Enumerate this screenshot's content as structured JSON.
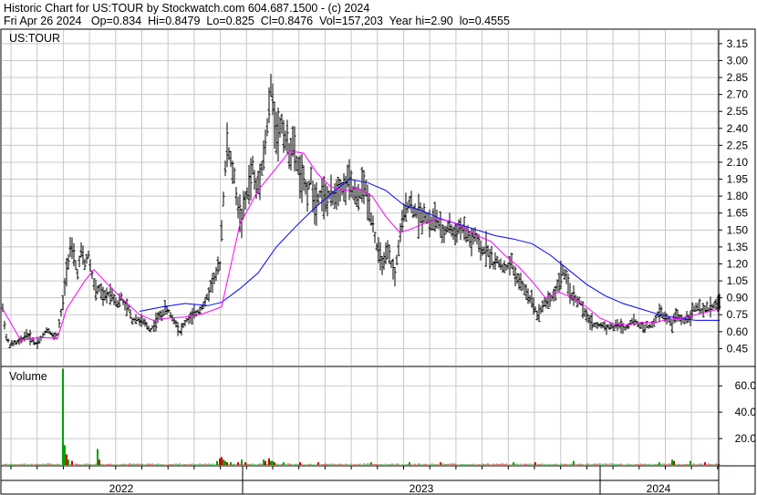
{
  "header": {
    "line1": "Historic Chart for US:TOUR by Stockwatch.com 604.687.1500 - (c) 2024",
    "line2": "Fri Apr 26 2024   Op=0.834  Hi=0.8479  Lo=0.825  Cl=0.8476  Vol=157,203  Year hi=2.90  lo=0.4555"
  },
  "chart_data": [
    {
      "type": "line",
      "title": "US:TOUR",
      "subtype": "OHLC price bars with two moving averages",
      "ylim": [
        0.3,
        3.27
      ],
      "y_ticks": [
        "3.15",
        "3.00",
        "2.85",
        "2.70",
        "2.55",
        "2.40",
        "2.25",
        "2.10",
        "1.95",
        "1.80",
        "1.65",
        "1.50",
        "1.35",
        "1.20",
        "1.05",
        "0.90",
        "0.75",
        "0.60",
        "0.45"
      ],
      "grid": true,
      "colors": {
        "short_ma": "#ff00ff",
        "long_ma": "#0000ff",
        "price": "#000000",
        "grid": "#c8c8c8"
      },
      "price_keypoints": [
        [
          0,
          0.8
        ],
        [
          4,
          0.55
        ],
        [
          8,
          0.48
        ],
        [
          14,
          0.5
        ],
        [
          20,
          0.52
        ],
        [
          26,
          0.58
        ],
        [
          32,
          0.53
        ],
        [
          36,
          0.5
        ],
        [
          40,
          0.52
        ],
        [
          44,
          0.56
        ],
        [
          48,
          0.62
        ],
        [
          52,
          0.6
        ],
        [
          56,
          0.55
        ],
        [
          60,
          0.58
        ],
        [
          66,
          0.85
        ],
        [
          70,
          1.15
        ],
        [
          74,
          1.35
        ],
        [
          78,
          1.25
        ],
        [
          82,
          1.12
        ],
        [
          86,
          1.3
        ],
        [
          90,
          1.2
        ],
        [
          94,
          1.28
        ],
        [
          98,
          1.1
        ],
        [
          102,
          0.95
        ],
        [
          106,
          0.98
        ],
        [
          110,
          0.9
        ],
        [
          114,
          0.92
        ],
        [
          118,
          0.95
        ],
        [
          122,
          0.9
        ],
        [
          126,
          0.85
        ],
        [
          130,
          0.9
        ],
        [
          134,
          0.82
        ],
        [
          138,
          0.8
        ],
        [
          142,
          0.7
        ],
        [
          146,
          0.72
        ],
        [
          150,
          0.7
        ],
        [
          154,
          0.68
        ],
        [
          158,
          0.65
        ],
        [
          162,
          0.62
        ],
        [
          166,
          0.66
        ],
        [
          170,
          0.72
        ],
        [
          174,
          0.75
        ],
        [
          178,
          0.8
        ],
        [
          182,
          0.78
        ],
        [
          186,
          0.72
        ],
        [
          190,
          0.68
        ],
        [
          194,
          0.6
        ],
        [
          198,
          0.65
        ],
        [
          202,
          0.7
        ],
        [
          206,
          0.72
        ],
        [
          210,
          0.75
        ],
        [
          214,
          0.78
        ],
        [
          218,
          0.82
        ],
        [
          222,
          0.85
        ],
        [
          226,
          0.95
        ],
        [
          230,
          1.05
        ],
        [
          234,
          1.1
        ],
        [
          238,
          1.2
        ],
        [
          242,
          1.8
        ],
        [
          246,
          2.25
        ],
        [
          250,
          2.1
        ],
        [
          254,
          1.95
        ],
        [
          258,
          1.7
        ],
        [
          262,
          1.6
        ],
        [
          266,
          1.75
        ],
        [
          270,
          1.9
        ],
        [
          274,
          2.05
        ],
        [
          278,
          1.85
        ],
        [
          282,
          2.0
        ],
        [
          286,
          2.15
        ],
        [
          290,
          2.4
        ],
        [
          294,
          2.75
        ],
        [
          298,
          2.5
        ],
        [
          302,
          2.35
        ],
        [
          306,
          2.45
        ],
        [
          310,
          2.3
        ],
        [
          314,
          2.2
        ],
        [
          318,
          2.25
        ],
        [
          322,
          2.1
        ],
        [
          326,
          2.0
        ],
        [
          330,
          1.9
        ],
        [
          334,
          1.85
        ],
        [
          338,
          1.95
        ],
        [
          342,
          1.75
        ],
        [
          346,
          1.8
        ],
        [
          350,
          1.85
        ],
        [
          354,
          1.75
        ],
        [
          358,
          1.8
        ],
        [
          362,
          1.78
        ],
        [
          366,
          1.85
        ],
        [
          370,
          1.9
        ],
        [
          374,
          1.85
        ],
        [
          378,
          1.95
        ],
        [
          382,
          1.88
        ],
        [
          386,
          1.8
        ],
        [
          390,
          1.75
        ],
        [
          394,
          1.9
        ],
        [
          398,
          1.85
        ],
        [
          402,
          1.7
        ],
        [
          406,
          1.55
        ],
        [
          410,
          1.35
        ],
        [
          414,
          1.25
        ],
        [
          418,
          1.2
        ],
        [
          422,
          1.3
        ],
        [
          426,
          1.2
        ],
        [
          430,
          1.1
        ],
        [
          434,
          1.35
        ],
        [
          438,
          1.55
        ],
        [
          442,
          1.7
        ],
        [
          446,
          1.75
        ],
        [
          450,
          1.68
        ],
        [
          454,
          1.65
        ],
        [
          458,
          1.62
        ],
        [
          462,
          1.65
        ],
        [
          466,
          1.6
        ],
        [
          470,
          1.55
        ],
        [
          474,
          1.62
        ],
        [
          478,
          1.55
        ],
        [
          482,
          1.45
        ],
        [
          486,
          1.5
        ],
        [
          490,
          1.55
        ],
        [
          494,
          1.45
        ],
        [
          498,
          1.5
        ],
        [
          502,
          1.52
        ],
        [
          506,
          1.48
        ],
        [
          510,
          1.45
        ],
        [
          514,
          1.4
        ],
        [
          518,
          1.45
        ],
        [
          522,
          1.35
        ],
        [
          526,
          1.3
        ],
        [
          530,
          1.35
        ],
        [
          534,
          1.28
        ],
        [
          538,
          1.2
        ],
        [
          542,
          1.22
        ],
        [
          546,
          1.2
        ],
        [
          550,
          1.15
        ],
        [
          554,
          1.18
        ],
        [
          558,
          1.2
        ],
        [
          562,
          1.1
        ],
        [
          566,
          1.05
        ],
        [
          570,
          1.0
        ],
        [
          574,
          0.95
        ],
        [
          578,
          0.9
        ],
        [
          582,
          0.85
        ],
        [
          586,
          0.75
        ],
        [
          590,
          0.8
        ],
        [
          594,
          0.85
        ],
        [
          598,
          0.88
        ],
        [
          602,
          0.9
        ],
        [
          606,
          0.95
        ],
        [
          610,
          1.05
        ],
        [
          614,
          1.15
        ],
        [
          618,
          1.05
        ],
        [
          622,
          0.95
        ],
        [
          626,
          0.9
        ],
        [
          630,
          0.88
        ],
        [
          634,
          0.85
        ],
        [
          638,
          0.75
        ],
        [
          642,
          0.72
        ],
        [
          646,
          0.68
        ],
        [
          650,
          0.66
        ],
        [
          654,
          0.65
        ],
        [
          658,
          0.66
        ],
        [
          662,
          0.64
        ],
        [
          666,
          0.65
        ],
        [
          670,
          0.64
        ],
        [
          674,
          0.66
        ],
        [
          678,
          0.65
        ],
        [
          682,
          0.63
        ],
        [
          686,
          0.66
        ],
        [
          690,
          0.7
        ],
        [
          694,
          0.68
        ],
        [
          698,
          0.66
        ],
        [
          702,
          0.64
        ],
        [
          706,
          0.65
        ],
        [
          710,
          0.64
        ],
        [
          714,
          0.68
        ],
        [
          718,
          0.75
        ],
        [
          722,
          0.78
        ],
        [
          726,
          0.72
        ],
        [
          730,
          0.7
        ],
        [
          734,
          0.66
        ],
        [
          738,
          0.75
        ],
        [
          742,
          0.72
        ],
        [
          746,
          0.7
        ],
        [
          750,
          0.72
        ],
        [
          754,
          0.75
        ],
        [
          758,
          0.8
        ],
        [
          762,
          0.82
        ],
        [
          766,
          0.78
        ],
        [
          770,
          0.8
        ],
        [
          774,
          0.8
        ],
        [
          778,
          0.83
        ],
        [
          782,
          0.84
        ],
        [
          786,
          0.85
        ]
      ],
      "short_ma_keypoints": [
        [
          0,
          0.8
        ],
        [
          20,
          0.52
        ],
        [
          40,
          0.55
        ],
        [
          60,
          0.54
        ],
        [
          70,
          0.8
        ],
        [
          90,
          1.05
        ],
        [
          100,
          1.15
        ],
        [
          115,
          1.02
        ],
        [
          130,
          0.9
        ],
        [
          150,
          0.75
        ],
        [
          165,
          0.7
        ],
        [
          180,
          0.72
        ],
        [
          200,
          0.73
        ],
        [
          220,
          0.76
        ],
        [
          240,
          0.82
        ],
        [
          260,
          1.55
        ],
        [
          280,
          1.85
        ],
        [
          300,
          2.05
        ],
        [
          315,
          2.2
        ],
        [
          330,
          2.18
        ],
        [
          345,
          2.0
        ],
        [
          360,
          1.88
        ],
        [
          375,
          1.85
        ],
        [
          390,
          1.87
        ],
        [
          405,
          1.8
        ],
        [
          420,
          1.62
        ],
        [
          435,
          1.48
        ],
        [
          445,
          1.5
        ],
        [
          460,
          1.55
        ],
        [
          475,
          1.6
        ],
        [
          490,
          1.58
        ],
        [
          505,
          1.52
        ],
        [
          520,
          1.45
        ],
        [
          535,
          1.4
        ],
        [
          550,
          1.28
        ],
        [
          565,
          1.18
        ],
        [
          580,
          1.05
        ],
        [
          595,
          0.9
        ],
        [
          610,
          0.95
        ],
        [
          625,
          0.9
        ],
        [
          640,
          0.82
        ],
        [
          655,
          0.72
        ],
        [
          670,
          0.67
        ],
        [
          685,
          0.66
        ],
        [
          700,
          0.68
        ],
        [
          715,
          0.68
        ],
        [
          730,
          0.71
        ],
        [
          745,
          0.72
        ],
        [
          760,
          0.75
        ],
        [
          775,
          0.78
        ],
        [
          786,
          0.8
        ]
      ],
      "long_ma_keypoints": [
        [
          150,
          0.78
        ],
        [
          175,
          0.82
        ],
        [
          200,
          0.85
        ],
        [
          225,
          0.83
        ],
        [
          240,
          0.86
        ],
        [
          260,
          0.98
        ],
        [
          280,
          1.12
        ],
        [
          300,
          1.35
        ],
        [
          320,
          1.52
        ],
        [
          340,
          1.68
        ],
        [
          360,
          1.82
        ],
        [
          380,
          1.95
        ],
        [
          400,
          1.92
        ],
        [
          420,
          1.85
        ],
        [
          440,
          1.72
        ],
        [
          460,
          1.67
        ],
        [
          480,
          1.6
        ],
        [
          500,
          1.55
        ],
        [
          520,
          1.5
        ],
        [
          540,
          1.45
        ],
        [
          560,
          1.42
        ],
        [
          580,
          1.38
        ],
        [
          600,
          1.28
        ],
        [
          620,
          1.15
        ],
        [
          640,
          1.02
        ],
        [
          660,
          0.92
        ],
        [
          680,
          0.85
        ],
        [
          700,
          0.8
        ],
        [
          720,
          0.75
        ],
        [
          740,
          0.72
        ],
        [
          760,
          0.7
        ],
        [
          786,
          0.7
        ]
      ]
    },
    {
      "type": "bar",
      "title": "Volume",
      "ylim": [
        0,
        74
      ],
      "y_ticks": [
        "60.0",
        "40.0",
        "20.0"
      ],
      "bars": [
        [
          66,
          73,
          "#00a000"
        ],
        [
          68,
          15,
          "#00a000"
        ],
        [
          70,
          8,
          "#cc0000"
        ],
        [
          72,
          4,
          "#00a000"
        ],
        [
          76,
          3,
          "#cc0000"
        ],
        [
          104,
          12,
          "#00a000"
        ],
        [
          106,
          4,
          "#cc0000"
        ],
        [
          235,
          3,
          "#00a000"
        ],
        [
          238,
          5,
          "#cc0000"
        ],
        [
          240,
          6,
          "#cc0000"
        ],
        [
          242,
          4,
          "#00a000"
        ],
        [
          244,
          3,
          "#00a000"
        ],
        [
          246,
          2,
          "#cc0000"
        ],
        [
          250,
          2,
          "#00a000"
        ],
        [
          258,
          2,
          "#cc0000"
        ],
        [
          262,
          4,
          "#00a000"
        ],
        [
          266,
          2,
          "#cc0000"
        ],
        [
          286,
          4,
          "#00a000"
        ],
        [
          288,
          3,
          "#cc0000"
        ],
        [
          292,
          5,
          "#cc0000"
        ],
        [
          294,
          3,
          "#00a000"
        ],
        [
          296,
          3,
          "#00a000"
        ],
        [
          298,
          2,
          "#cc0000"
        ],
        [
          308,
          2,
          "#00a000"
        ],
        [
          326,
          2,
          "#cc0000"
        ],
        [
          346,
          2,
          "#cc0000"
        ],
        [
          404,
          2,
          "#00a000"
        ],
        [
          446,
          2,
          "#00a000"
        ],
        [
          480,
          2,
          "#cc0000"
        ],
        [
          560,
          2,
          "#00a000"
        ],
        [
          584,
          2,
          "#cc0000"
        ],
        [
          626,
          3,
          "#00a000"
        ],
        [
          720,
          2,
          "#00a000"
        ],
        [
          734,
          4,
          "#00a000"
        ],
        [
          736,
          3,
          "#cc0000"
        ],
        [
          754,
          3,
          "#00a000"
        ],
        [
          770,
          2,
          "#cc0000"
        ]
      ]
    }
  ],
  "price_panel_label": "US:TOUR",
  "volume_panel_label": "Volume",
  "volume_ticks": [
    "60.0",
    "40.0",
    "20.0"
  ],
  "x_axis": {
    "labels": [
      "2022",
      "2023",
      "2024"
    ]
  }
}
